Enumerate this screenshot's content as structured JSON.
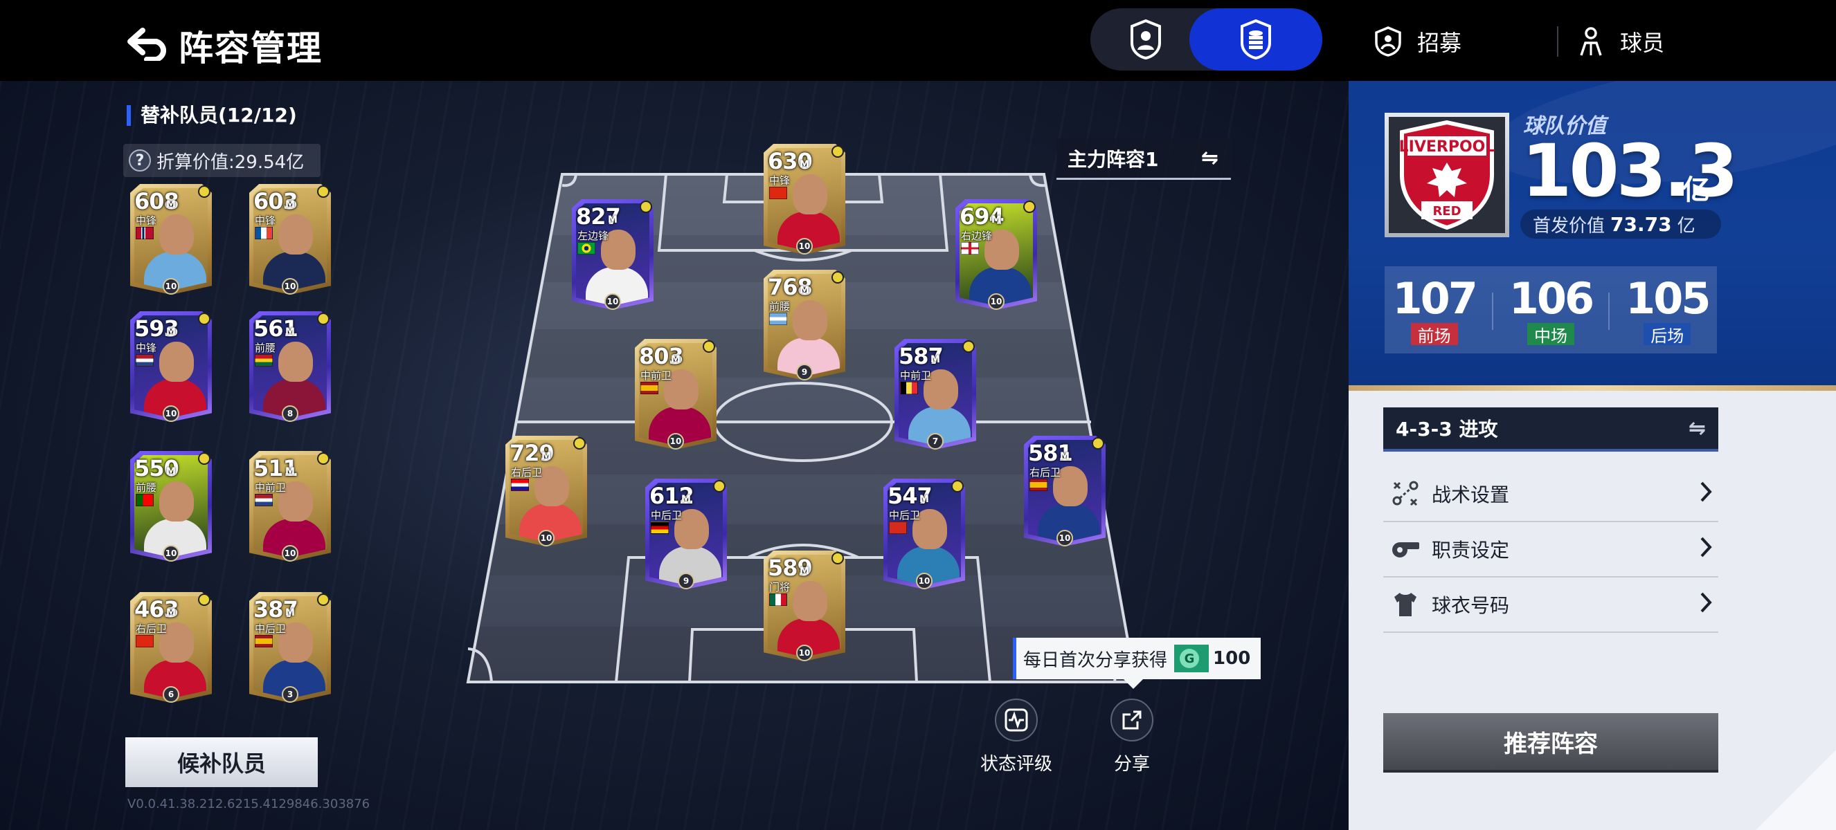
{
  "header": {
    "title": "阵容管理",
    "recruit_label": "招募",
    "players_label": "球员"
  },
  "bench": {
    "heading": "替补队员(12/12)",
    "value_label": "折算价值:29.54亿",
    "subs_button": "候补队员",
    "players": [
      {
        "ovr": "608",
        "pos": "中锋",
        "lvl": "10",
        "flag": "NOR",
        "tier": "gold",
        "kit": "#6cabdd"
      },
      {
        "ovr": "603",
        "pos": "中锋",
        "lvl": "10",
        "flag": "FRA",
        "tier": "gold",
        "kit": "#1b2a55"
      },
      {
        "ovr": "593",
        "pos": "中锋",
        "lvl": "10",
        "flag": "NED",
        "tier": "purple",
        "kit": "#c8102e"
      },
      {
        "ovr": "561",
        "pos": "前腰",
        "lvl": "8",
        "flag": "GHA",
        "tier": "purple",
        "kit": "#8a1538"
      },
      {
        "ovr": "550",
        "pos": "前腰",
        "lvl": "10",
        "flag": "POR",
        "tier": "purple-green",
        "kit": "#e8e8e8"
      },
      {
        "ovr": "511",
        "pos": "中前卫",
        "lvl": "10",
        "flag": "NED",
        "tier": "gold",
        "kit": "#a50044"
      },
      {
        "ovr": "463",
        "pos": "右后卫",
        "lvl": "6",
        "flag": "CHN",
        "tier": "gold",
        "kit": "#c8102e"
      },
      {
        "ovr": "387",
        "pos": "中后卫",
        "lvl": "3",
        "flag": "ESP",
        "tier": "gold",
        "kit": "#1d3c8c"
      }
    ]
  },
  "version": "V0.0.41.38.212.6215.4129846.303876",
  "lineup": {
    "selector_label": "主力阵容1",
    "players": [
      {
        "id": "st",
        "ovr": "630",
        "pos": "中锋",
        "lvl": "10",
        "flag": "CHN",
        "tier": "gold",
        "kit": "#c8102e"
      },
      {
        "id": "lw",
        "ovr": "827",
        "pos": "左边锋",
        "lvl": "10",
        "flag": "BRA",
        "tier": "purple",
        "kit": "#f2f2f2"
      },
      {
        "id": "rw",
        "ovr": "694",
        "pos": "右边锋",
        "lvl": "10",
        "flag": "ENG",
        "tier": "purple-green",
        "kit": "#1b3f8f"
      },
      {
        "id": "cam",
        "ovr": "768",
        "pos": "前腰",
        "lvl": "9",
        "flag": "ARG",
        "tier": "gold",
        "kit": "#f4c3d4"
      },
      {
        "id": "lcm",
        "ovr": "803",
        "pos": "中前卫",
        "lvl": "10",
        "flag": "ESP",
        "tier": "gold",
        "kit": "#a50044"
      },
      {
        "id": "rcm",
        "ovr": "587",
        "pos": "中前卫",
        "lvl": "7",
        "flag": "BEL",
        "tier": "purple",
        "kit": "#6cabdd"
      },
      {
        "id": "rb",
        "ovr": "729",
        "pos": "右后卫",
        "lvl": "10",
        "flag": "CRO",
        "tier": "gold",
        "kit": "#e84a4a"
      },
      {
        "id": "lcb",
        "ovr": "612",
        "pos": "中后卫",
        "lvl": "9",
        "flag": "GER",
        "tier": "purple",
        "kit": "#cfcfcf"
      },
      {
        "id": "rcb",
        "ovr": "547",
        "pos": "中后卫",
        "lvl": "10",
        "flag": "SUI",
        "tier": "purple",
        "kit": "#2b7fb5"
      },
      {
        "id": "lb",
        "ovr": "581",
        "pos": "右后卫",
        "lvl": "10",
        "flag": "ESP",
        "tier": "purple",
        "kit": "#1d3c8c"
      },
      {
        "id": "gk",
        "ovr": "589",
        "pos": "门将",
        "lvl": "10",
        "flag": "MEX",
        "tier": "gold",
        "kit": "#c8102e"
      }
    ]
  },
  "share": {
    "tip_text": "每日首次分享获得",
    "coin_letter": "G",
    "coin_amount": "100",
    "status_label": "状态评级",
    "share_label": "分享"
  },
  "team": {
    "club": "LIVERPOOL",
    "club_sub": "RED",
    "value_label": "球队价值",
    "value": "103.3",
    "value_unit": "亿",
    "starter_label": "首发价值",
    "starter_value": "73.73",
    "starter_unit": "亿",
    "ratings": [
      {
        "value": "107",
        "label": "前场",
        "color": "#c62f3b"
      },
      {
        "value": "106",
        "label": "中场",
        "color": "#1f8a4c"
      },
      {
        "value": "105",
        "label": "后场",
        "color": "#1f4fae"
      }
    ]
  },
  "tactics": {
    "formation_label": "4-3-3 进攻",
    "menu": [
      "战术设置",
      "职责设定",
      "球衣号码"
    ],
    "recommend_button": "推荐阵容"
  },
  "colors": {
    "accent": "#1133d6",
    "panel_blue": "#0f3b93",
    "gold": "#c9a46a"
  }
}
